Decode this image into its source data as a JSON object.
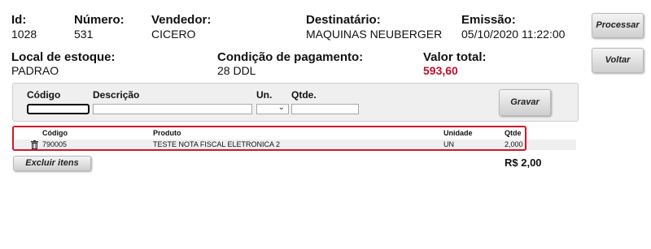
{
  "header": {
    "id_label": "Id:",
    "id_value": "1028",
    "numero_label": "Número:",
    "numero_value": "531",
    "vendedor_label": "Vendedor:",
    "vendedor_value": "CICERO",
    "destinatario_label": "Destinatário:",
    "destinatario_value": "MAQUINAS NEUBERGER",
    "emissao_label": "Emissão:",
    "emissao_value": "05/10/2020 11:22:00",
    "local_label": "Local de estoque:",
    "local_value": "PADRAO",
    "condicao_label": "Condição de pagamento:",
    "condicao_value": "28 DDL",
    "valor_label": "Valor total:",
    "valor_value": "593,60"
  },
  "actions": {
    "processar": "Processar",
    "voltar": "Voltar"
  },
  "entry_form": {
    "codigo_label": "Código",
    "descricao_label": "Descrição",
    "un_label": "Un.",
    "qtde_label": "Qtde.",
    "codigo_value": "",
    "descricao_value": "",
    "un_value": "",
    "qtde_value": "",
    "gravar": "Gravar"
  },
  "items_table": {
    "columns": {
      "codigo": "Código",
      "produto": "Produto",
      "unidade": "Unidade",
      "qtde": "Qtde"
    },
    "rows": [
      {
        "codigo": "790005",
        "produto": "TESTE NOTA FISCAL ELETRONICA 2",
        "unidade": "UN",
        "qtde": "2,000"
      }
    ]
  },
  "footer": {
    "excluir": "Excluir itens",
    "total": "R$ 2,00"
  },
  "colors": {
    "accent_red": "#c0102a",
    "highlight_border": "#d3162c"
  },
  "icons": {
    "row_delete": "trash-icon",
    "select": "chevron-down-icon"
  }
}
